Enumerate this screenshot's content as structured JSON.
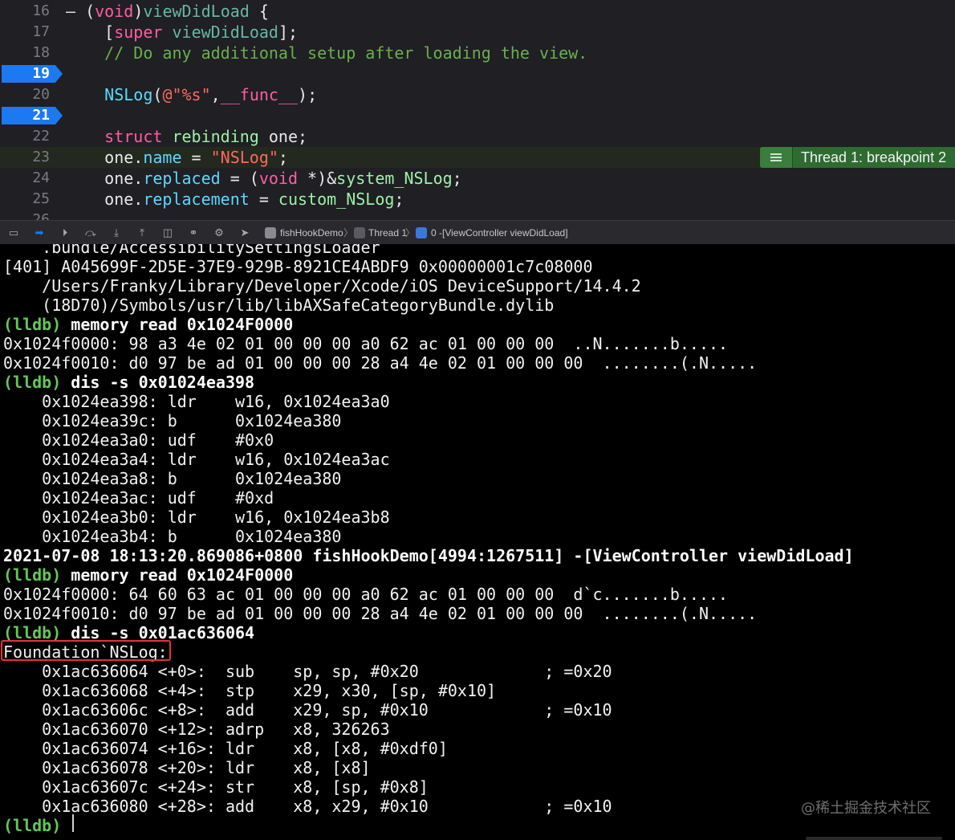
{
  "editor": {
    "lines": [
      {
        "num": "16",
        "parts": [
          [
            "fold",
            "– "
          ],
          [
            "plain",
            "("
          ],
          [
            "kw",
            "void"
          ],
          [
            "plain",
            ")"
          ],
          [
            "fn",
            "viewDidLoad"
          ],
          [
            "plain",
            " {"
          ]
        ]
      },
      {
        "num": "17",
        "parts": [
          [
            "plain",
            "    ["
          ],
          [
            "kw",
            "super"
          ],
          [
            "plain",
            " "
          ],
          [
            "fn",
            "viewDidLoad"
          ],
          [
            "plain",
            "];"
          ]
        ]
      },
      {
        "num": "18",
        "parts": [
          [
            "cmt",
            "    // Do any additional setup after loading the view."
          ]
        ]
      },
      {
        "num": "19",
        "breakpoint": true,
        "parts": []
      },
      {
        "num": "20",
        "parts": [
          [
            "plain",
            "    "
          ],
          [
            "type",
            "NSLog"
          ],
          [
            "plain",
            "("
          ],
          [
            "str",
            "@\"%s\""
          ],
          [
            "plain",
            ","
          ],
          [
            "kw",
            "__func__"
          ],
          [
            "plain",
            ");"
          ]
        ]
      },
      {
        "num": "21",
        "breakpoint": true,
        "parts": []
      },
      {
        "num": "22",
        "parts": [
          [
            "plain",
            "    "
          ],
          [
            "kw",
            "struct"
          ],
          [
            "plain",
            " "
          ],
          [
            "green",
            "rebinding"
          ],
          [
            "plain",
            " one;"
          ]
        ]
      },
      {
        "num": "23",
        "current": true,
        "parts": [
          [
            "plain",
            "    one."
          ],
          [
            "type",
            "name"
          ],
          [
            "plain",
            " = "
          ],
          [
            "str",
            "\"NSLog\""
          ],
          [
            "plain",
            ";"
          ]
        ]
      },
      {
        "num": "24",
        "parts": [
          [
            "plain",
            "    one."
          ],
          [
            "type",
            "replaced"
          ],
          [
            "plain",
            " = ("
          ],
          [
            "kw",
            "void"
          ],
          [
            "plain",
            " *)&"
          ],
          [
            "green",
            "system_NSLog"
          ],
          [
            "plain",
            ";"
          ]
        ]
      },
      {
        "num": "25",
        "parts": [
          [
            "plain",
            "    one."
          ],
          [
            "type",
            "replacement"
          ],
          [
            "plain",
            " = "
          ],
          [
            "green",
            "custom_NSLog"
          ],
          [
            "plain",
            ";"
          ]
        ]
      },
      {
        "num": "26",
        "parts": []
      }
    ],
    "thread_badge": "Thread 1: breakpoint 2"
  },
  "debugbar": {
    "project": "fishHookDemo",
    "thread": "Thread 1",
    "frame": "0 -[ViewController viewDidLoad]"
  },
  "console": {
    "lines": [
      {
        "kind": "out",
        "text": "    .bundle/AccessibilitySettingsLoader"
      },
      {
        "kind": "out",
        "text": "[401] A045699F-2D5E-37E9-929B-8921CE4ABDF9 0x00000001c7c08000"
      },
      {
        "kind": "out",
        "text": "    /Users/Franky/Library/Developer/Xcode/iOS DeviceSupport/14.4.2"
      },
      {
        "kind": "out",
        "text": "    (18D70)/Symbols/usr/lib/libAXSafeCategoryBundle.dylib"
      },
      {
        "kind": "prompt",
        "prompt": "(lldb)",
        "text": " memory read 0x1024F0000"
      },
      {
        "kind": "out",
        "text": "0x1024f0000: 98 a3 4e 02 01 00 00 00 a0 62 ac 01 00 00 00  ..N.......b....."
      },
      {
        "kind": "out",
        "text": "0x1024f0010: d0 97 be ad 01 00 00 00 28 a4 4e 02 01 00 00 00  ........(.N....."
      },
      {
        "kind": "prompt",
        "prompt": "(lldb)",
        "text": " dis -s 0x01024ea398"
      },
      {
        "kind": "out",
        "text": "    0x1024ea398: ldr    w16, 0x1024ea3a0"
      },
      {
        "kind": "out",
        "text": "    0x1024ea39c: b      0x1024ea380"
      },
      {
        "kind": "out",
        "text": "    0x1024ea3a0: udf    #0x0"
      },
      {
        "kind": "out",
        "text": "    0x1024ea3a4: ldr    w16, 0x1024ea3ac"
      },
      {
        "kind": "out",
        "text": "    0x1024ea3a8: b      0x1024ea380"
      },
      {
        "kind": "out",
        "text": "    0x1024ea3ac: udf    #0xd"
      },
      {
        "kind": "out",
        "text": "    0x1024ea3b0: ldr    w16, 0x1024ea3b8"
      },
      {
        "kind": "out",
        "text": "    0x1024ea3b4: b      0x1024ea380"
      },
      {
        "kind": "bold",
        "text": "2021-07-08 18:13:20.869086+0800 fishHookDemo[4994:1267511] -[ViewController viewDidLoad]"
      },
      {
        "kind": "prompt",
        "prompt": "(lldb)",
        "text": " memory read 0x1024F0000"
      },
      {
        "kind": "out",
        "text": "0x1024f0000: 64 60 63 ac 01 00 00 00 a0 62 ac 01 00 00 00  d`c.......b....."
      },
      {
        "kind": "out",
        "text": "0x1024f0010: d0 97 be ad 01 00 00 00 28 a4 4e 02 01 00 00 00  ........(.N....."
      },
      {
        "kind": "prompt",
        "prompt": "(lldb)",
        "text": " dis -s 0x01ac636064"
      },
      {
        "kind": "out",
        "text": "Foundation`NSLog:"
      },
      {
        "kind": "out",
        "text": "    0x1ac636064 <+0>:  sub    sp, sp, #0x20             ; =0x20"
      },
      {
        "kind": "out",
        "text": "    0x1ac636068 <+4>:  stp    x29, x30, [sp, #0x10]"
      },
      {
        "kind": "out",
        "text": "    0x1ac63606c <+8>:  add    x29, sp, #0x10            ; =0x10"
      },
      {
        "kind": "out",
        "text": "    0x1ac636070 <+12>: adrp   x8, 326263"
      },
      {
        "kind": "out",
        "text": "    0x1ac636074 <+16>: ldr    x8, [x8, #0xdf0]"
      },
      {
        "kind": "out",
        "text": "    0x1ac636078 <+20>: ldr    x8, [x8]"
      },
      {
        "kind": "out",
        "text": "    0x1ac63607c <+24>: str    x8, [sp, #0x8]"
      },
      {
        "kind": "out",
        "text": "    0x1ac636080 <+28>: add    x8, x29, #0x10            ; =0x10"
      },
      {
        "kind": "prompt",
        "prompt": "(lldb)",
        "text": ""
      }
    ],
    "watermark": "@稀土掘金技术社区"
  }
}
